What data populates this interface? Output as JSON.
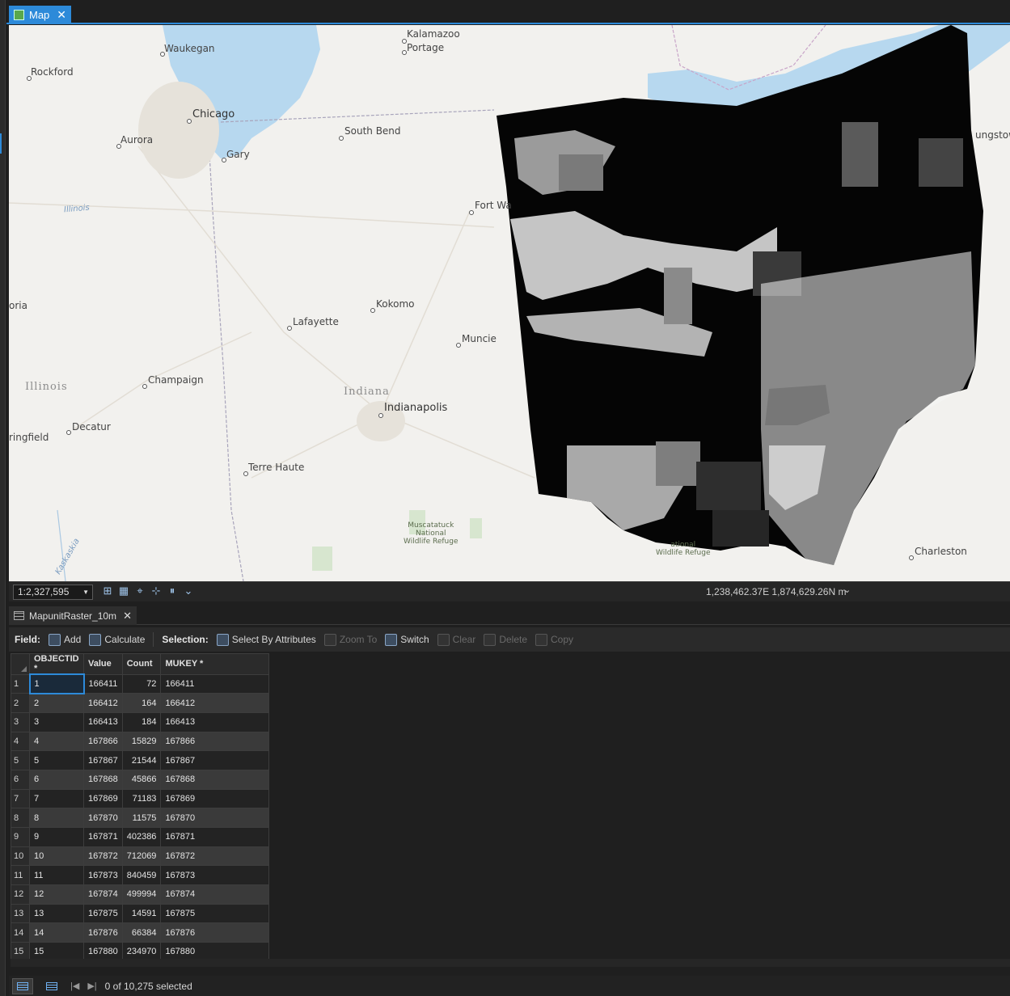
{
  "map_tab": {
    "label": "Map"
  },
  "map": {
    "labels": {
      "kalamazoo": "Kalamazoo",
      "portage": "Portage",
      "waukegan": "Waukegan",
      "rockford": "Rockford",
      "chicago": "Chicago",
      "aurora": "Aurora",
      "gary": "Gary",
      "south_bend": "South Bend",
      "fort_wayne": "Fort Wa",
      "illinois_river": "Illinois",
      "youngstown": "ungstown",
      "peoria": "oria",
      "kokomo": "Kokomo",
      "lafayette": "Lafayette",
      "muncie": "Muncie",
      "illinois_state": "Illinois",
      "champaign": "Champaign",
      "indiana_state": "Indiana",
      "indianapolis": "Indianapolis",
      "decatur": "Decatur",
      "springfield": "ringfield",
      "terre_haute": "Terre Haute",
      "muscatatuck": "Muscatatuck\nNational\nWildlife Refuge",
      "national_wildlife": "ational\nWildlife Refuge",
      "charleston": "Charleston",
      "kaskaskia": "Kaskaskia"
    }
  },
  "status": {
    "scale": "1:2,327,595",
    "coordinates": "1,238,462.37E 1,874,629.26N m"
  },
  "table_tab": {
    "label": "MapunitRaster_10m"
  },
  "toolbar": {
    "field_label": "Field:",
    "add": "Add",
    "calculate": "Calculate",
    "selection_label": "Selection:",
    "select_by_attributes": "Select By Attributes",
    "zoom_to": "Zoom To",
    "switch": "Switch",
    "clear": "Clear",
    "delete": "Delete",
    "copy": "Copy"
  },
  "table": {
    "columns": [
      "OBJECTID *",
      "Value",
      "Count",
      "MUKEY *"
    ],
    "rows": [
      [
        "1",
        "166411",
        "72",
        "166411"
      ],
      [
        "2",
        "166412",
        "164",
        "166412"
      ],
      [
        "3",
        "166413",
        "184",
        "166413"
      ],
      [
        "4",
        "167866",
        "15829",
        "167866"
      ],
      [
        "5",
        "167867",
        "21544",
        "167867"
      ],
      [
        "6",
        "167868",
        "45866",
        "167868"
      ],
      [
        "7",
        "167869",
        "71183",
        "167869"
      ],
      [
        "8",
        "167870",
        "11575",
        "167870"
      ],
      [
        "9",
        "167871",
        "402386",
        "167871"
      ],
      [
        "10",
        "167872",
        "712069",
        "167872"
      ],
      [
        "11",
        "167873",
        "840459",
        "167873"
      ],
      [
        "12",
        "167874",
        "499994",
        "167874"
      ],
      [
        "13",
        "167875",
        "14591",
        "167875"
      ],
      [
        "14",
        "167876",
        "66384",
        "167876"
      ],
      [
        "15",
        "167880",
        "234970",
        "167880"
      ]
    ]
  },
  "selection_status": "0 of 10,275 selected"
}
